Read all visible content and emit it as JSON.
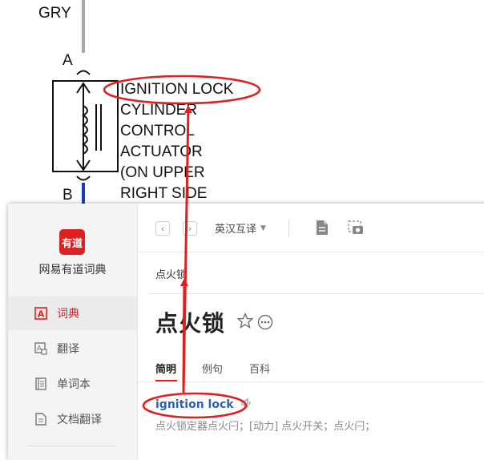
{
  "diagram": {
    "wire_color": "GRY",
    "pin_a": "A",
    "pin_b": "B",
    "component_label": [
      "IGNITION LOCK",
      "CYLINDER",
      "CONTROL",
      "ACTUATOR",
      "(ON UPPER",
      "RIGHT SIDE"
    ]
  },
  "app": {
    "logo_text": "有道",
    "name": "网易有道词典",
    "nav": [
      {
        "label": "词典",
        "icon": "dictionary-icon",
        "active": true
      },
      {
        "label": "翻译",
        "icon": "translate-icon",
        "active": false
      },
      {
        "label": "单词本",
        "icon": "wordbook-icon",
        "active": false
      },
      {
        "label": "文档翻译",
        "icon": "document-translate-icon",
        "active": false
      }
    ],
    "toolbar": {
      "back": "‹",
      "forward": "›",
      "mode": "英汉互译",
      "icons": [
        "document-icon",
        "screenshot-icon"
      ]
    },
    "search": {
      "value": "点火锁"
    },
    "word": "点火锁",
    "tabs": [
      "简明",
      "例句",
      "百科"
    ],
    "active_tab": "简明",
    "entry": {
      "term": "ignition lock",
      "meaning": "点火锁定器点火闩；[动力] 点火开关；点火闩；"
    }
  },
  "colors": {
    "accent": "#e02020",
    "link": "#2a62b6",
    "annotation": "#e02020"
  }
}
